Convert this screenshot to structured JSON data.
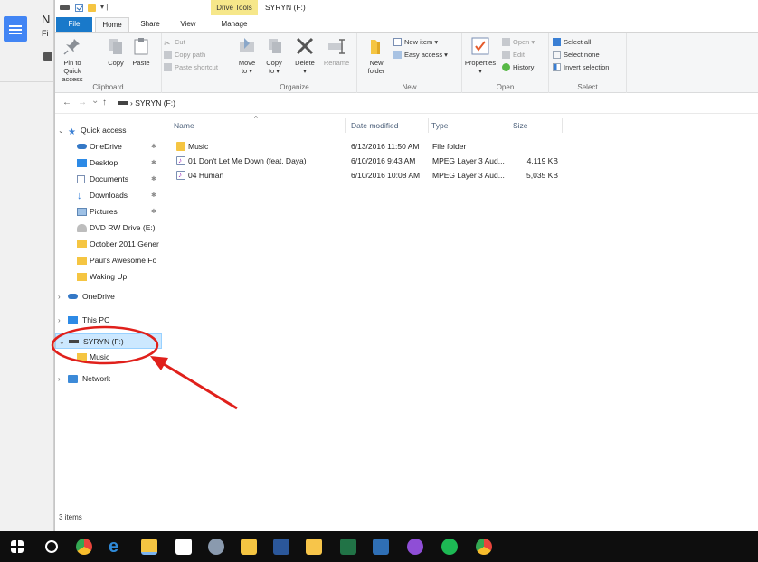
{
  "background_app": {
    "letter1": "N",
    "letter2": "Fi"
  },
  "titlebar": {
    "quick_access_dropdown": "▾ |",
    "contextual_tab": "Drive Tools",
    "title": "SYRYN (F:)"
  },
  "tabs": {
    "file": "File",
    "home": "Home",
    "share": "Share",
    "view": "View",
    "manage": "Manage"
  },
  "ribbon": {
    "clipboard": {
      "pin": "Pin to Quick access",
      "copy": "Copy",
      "paste": "Paste",
      "cut": "Cut",
      "copy_path": "Copy path",
      "paste_shortcut": "Paste shortcut",
      "label": "Clipboard"
    },
    "organize": {
      "move_to": "Move to ▾",
      "copy_to": "Copy to ▾",
      "delete": "Delete",
      "delete_arrow": "▾",
      "rename": "Rename",
      "label": "Organize"
    },
    "new": {
      "new_folder": "New folder",
      "new_item": "New item ▾",
      "easy_access": "Easy access ▾",
      "label": "New"
    },
    "open": {
      "properties": "Properties",
      "properties_arrow": "▾",
      "open": "Open ▾",
      "edit": "Edit",
      "history": "History",
      "label": "Open"
    },
    "select": {
      "select_all": "Select all",
      "select_none": "Select none",
      "invert": "Invert selection",
      "label": "Select"
    }
  },
  "address": {
    "back": "←",
    "forward": "→",
    "recent": "⌄",
    "up": "↑",
    "separator": "›",
    "path": "SYRYN (F:)"
  },
  "nav": {
    "quick_access": "Quick access",
    "items": [
      "OneDrive",
      "Desktop",
      "Documents",
      "Downloads",
      "Pictures",
      "DVD RW Drive (E:)",
      "October 2011 Gener",
      "Paul's Awesome Fo",
      "Waking Up"
    ],
    "onedrive": "OneDrive",
    "this_pc": "This PC",
    "drive": "SYRYN (F:)",
    "music": "Music",
    "network": "Network"
  },
  "columns": {
    "name": "Name",
    "date": "Date modified",
    "type": "Type",
    "size": "Size"
  },
  "files": [
    {
      "name": "Music",
      "date": "6/13/2016 11:50 AM",
      "type": "File folder",
      "size": ""
    },
    {
      "name": "01 Don't Let Me Down (feat. Daya)",
      "date": "6/10/2016 9:43 AM",
      "type": "MPEG Layer 3 Aud...",
      "size": "4,119 KB"
    },
    {
      "name": "04 Human",
      "date": "6/10/2016 10:08 AM",
      "type": "MPEG Layer 3 Aud...",
      "size": "5,035 KB"
    }
  ],
  "status": {
    "count": "3 items"
  },
  "colors": {
    "file_tab": "#1979ca",
    "selection": "#cce8ff",
    "annotation": "#e0201b",
    "folder": "#f5c542"
  }
}
